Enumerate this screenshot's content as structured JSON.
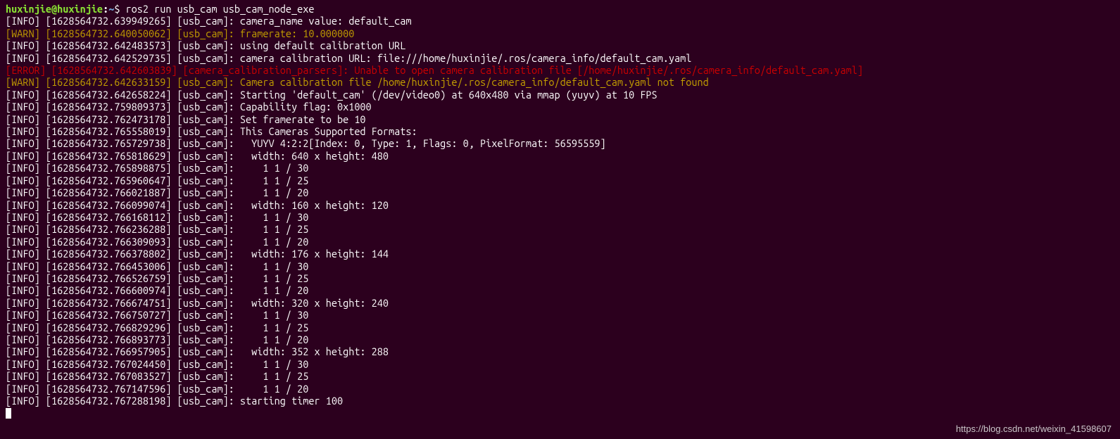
{
  "prompt": {
    "user": "huxinjie",
    "host": "huxinjie",
    "path": "~",
    "symbol": "$"
  },
  "command": "ros2 run usb_cam usb_cam_node_exe",
  "watermark": "https://blog.csdn.net/weixin_41598607",
  "lines": [
    {
      "level": "INFO",
      "ts": "1628564732.639949265",
      "node": "usb_cam",
      "msg": "camera_name value: default_cam"
    },
    {
      "level": "WARN",
      "ts": "1628564732.640050062",
      "node": "usb_cam",
      "msg": "framerate: 10.000000"
    },
    {
      "level": "INFO",
      "ts": "1628564732.642483573",
      "node": "usb_cam",
      "msg": "using default calibration URL"
    },
    {
      "level": "INFO",
      "ts": "1628564732.642529735",
      "node": "usb_cam",
      "msg": "camera calibration URL: file:///home/huxinjie/.ros/camera_info/default_cam.yaml"
    },
    {
      "level": "ERROR",
      "ts": "1628564732.642603839",
      "node": "camera_calibration_parsers",
      "msg": "Unable to open camera calibration file [/home/huxinjie/.ros/camera_info/default_cam.yaml]"
    },
    {
      "level": "WARN",
      "ts": "1628564732.642633159",
      "node": "usb_cam",
      "msg": "Camera calibration file /home/huxinjie/.ros/camera_info/default_cam.yaml not found"
    },
    {
      "level": "INFO",
      "ts": "1628564732.642658224",
      "node": "usb_cam",
      "msg": "Starting 'default_cam' (/dev/video0) at 640x480 via mmap (yuyv) at 10 FPS"
    },
    {
      "level": "INFO",
      "ts": "1628564732.759809373",
      "node": "usb_cam",
      "msg": "Capability flag: 0x1000"
    },
    {
      "level": "INFO",
      "ts": "1628564732.762473178",
      "node": "usb_cam",
      "msg": "Set framerate to be 10"
    },
    {
      "level": "INFO",
      "ts": "1628564732.765558019",
      "node": "usb_cam",
      "msg": "This Cameras Supported Formats:"
    },
    {
      "level": "INFO",
      "ts": "1628564732.765729738",
      "node": "usb_cam",
      "msg": "  YUYV 4:2:2[Index: 0, Type: 1, Flags: 0, PixelFormat: 56595559]"
    },
    {
      "level": "INFO",
      "ts": "1628564732.765818629",
      "node": "usb_cam",
      "msg": "  width: 640 x height: 480"
    },
    {
      "level": "INFO",
      "ts": "1628564732.765898875",
      "node": "usb_cam",
      "msg": "    1 1 / 30"
    },
    {
      "level": "INFO",
      "ts": "1628564732.765960647",
      "node": "usb_cam",
      "msg": "    1 1 / 25"
    },
    {
      "level": "INFO",
      "ts": "1628564732.766021887",
      "node": "usb_cam",
      "msg": "    1 1 / 20"
    },
    {
      "level": "INFO",
      "ts": "1628564732.766099074",
      "node": "usb_cam",
      "msg": "  width: 160 x height: 120"
    },
    {
      "level": "INFO",
      "ts": "1628564732.766168112",
      "node": "usb_cam",
      "msg": "    1 1 / 30"
    },
    {
      "level": "INFO",
      "ts": "1628564732.766236288",
      "node": "usb_cam",
      "msg": "    1 1 / 25"
    },
    {
      "level": "INFO",
      "ts": "1628564732.766309093",
      "node": "usb_cam",
      "msg": "    1 1 / 20"
    },
    {
      "level": "INFO",
      "ts": "1628564732.766378802",
      "node": "usb_cam",
      "msg": "  width: 176 x height: 144"
    },
    {
      "level": "INFO",
      "ts": "1628564732.766453006",
      "node": "usb_cam",
      "msg": "    1 1 / 30"
    },
    {
      "level": "INFO",
      "ts": "1628564732.766526759",
      "node": "usb_cam",
      "msg": "    1 1 / 25"
    },
    {
      "level": "INFO",
      "ts": "1628564732.766600974",
      "node": "usb_cam",
      "msg": "    1 1 / 20"
    },
    {
      "level": "INFO",
      "ts": "1628564732.766674751",
      "node": "usb_cam",
      "msg": "  width: 320 x height: 240"
    },
    {
      "level": "INFO",
      "ts": "1628564732.766750727",
      "node": "usb_cam",
      "msg": "    1 1 / 30"
    },
    {
      "level": "INFO",
      "ts": "1628564732.766829296",
      "node": "usb_cam",
      "msg": "    1 1 / 25"
    },
    {
      "level": "INFO",
      "ts": "1628564732.766893773",
      "node": "usb_cam",
      "msg": "    1 1 / 20"
    },
    {
      "level": "INFO",
      "ts": "1628564732.766957905",
      "node": "usb_cam",
      "msg": "  width: 352 x height: 288"
    },
    {
      "level": "INFO",
      "ts": "1628564732.767024450",
      "node": "usb_cam",
      "msg": "    1 1 / 30"
    },
    {
      "level": "INFO",
      "ts": "1628564732.767083527",
      "node": "usb_cam",
      "msg": "    1 1 / 25"
    },
    {
      "level": "INFO",
      "ts": "1628564732.767147596",
      "node": "usb_cam",
      "msg": "    1 1 / 20"
    },
    {
      "level": "INFO",
      "ts": "1628564732.767288198",
      "node": "usb_cam",
      "msg": "starting timer 100"
    }
  ]
}
